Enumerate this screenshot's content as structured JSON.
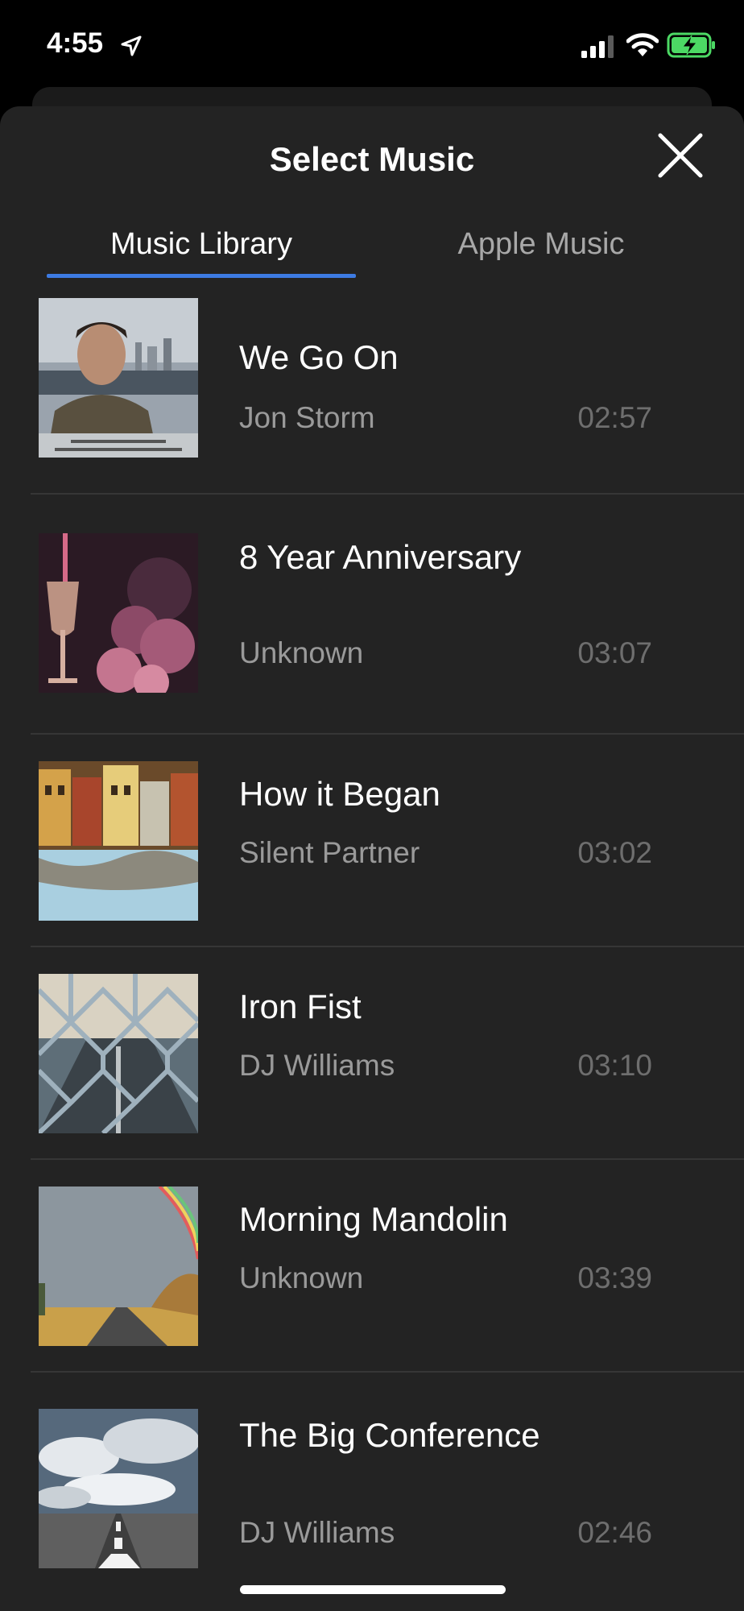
{
  "status_bar": {
    "time": "4:55",
    "icons": [
      "location-arrow-icon",
      "cellular-signal-icon",
      "wifi-icon",
      "battery-charging-icon"
    ],
    "battery_color": "#4cd964"
  },
  "header": {
    "title": "Select Music",
    "close_icon": "close-icon"
  },
  "tabs": [
    {
      "label": "Music Library",
      "active": true
    },
    {
      "label": "Apple Music",
      "active": false
    }
  ],
  "accent_color": "#3d7be3",
  "tracks": [
    {
      "title": "We Go On",
      "artist": "Jon Storm",
      "duration": "02:57"
    },
    {
      "title": "8 Year Anniversary",
      "artist": "Unknown",
      "duration": "03:07"
    },
    {
      "title": "How it Began",
      "artist": "Silent Partner",
      "duration": "03:02"
    },
    {
      "title": "Iron Fist",
      "artist": "DJ Williams",
      "duration": "03:10"
    },
    {
      "title": "Morning Mandolin",
      "artist": "Unknown",
      "duration": "03:39"
    },
    {
      "title": "The Big Conference",
      "artist": "DJ Williams",
      "duration": "02:46"
    }
  ]
}
